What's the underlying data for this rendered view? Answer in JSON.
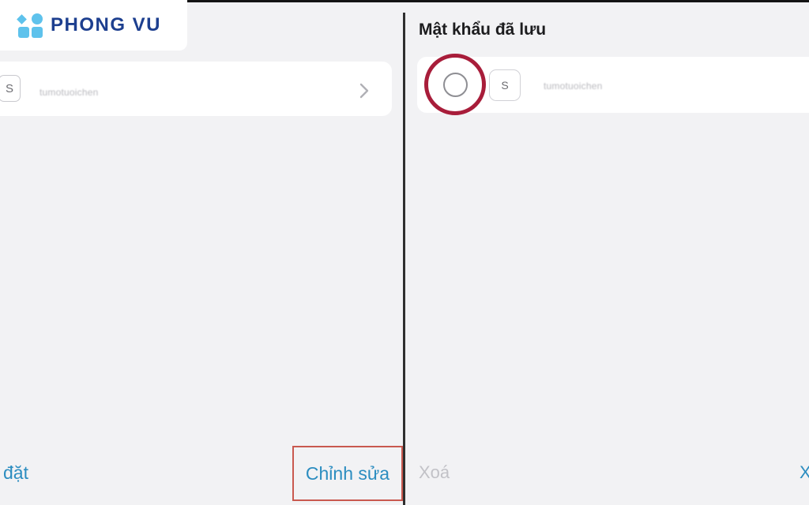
{
  "brand": {
    "name": "PHONG VU",
    "primary_color": "#1d3f8f",
    "accent_color": "#5ec2ec"
  },
  "left_panel": {
    "row": {
      "icon_letter": "S",
      "username": "tumotuoichen",
      "chevron": "chevron-right-icon"
    },
    "bottom_left_label": "đặt",
    "edit_label": "Chỉnh sửa"
  },
  "right_panel": {
    "title": "Mật khẩu đã lưu",
    "row": {
      "icon_letter": "S",
      "username": "tumotuoichen"
    },
    "delete_label": "Xoá",
    "right_edge_label": "X"
  },
  "colors": {
    "link": "#2c8dc0",
    "highlight_ring": "#a81d3a",
    "edit_highlight_box": "#c9594f"
  }
}
